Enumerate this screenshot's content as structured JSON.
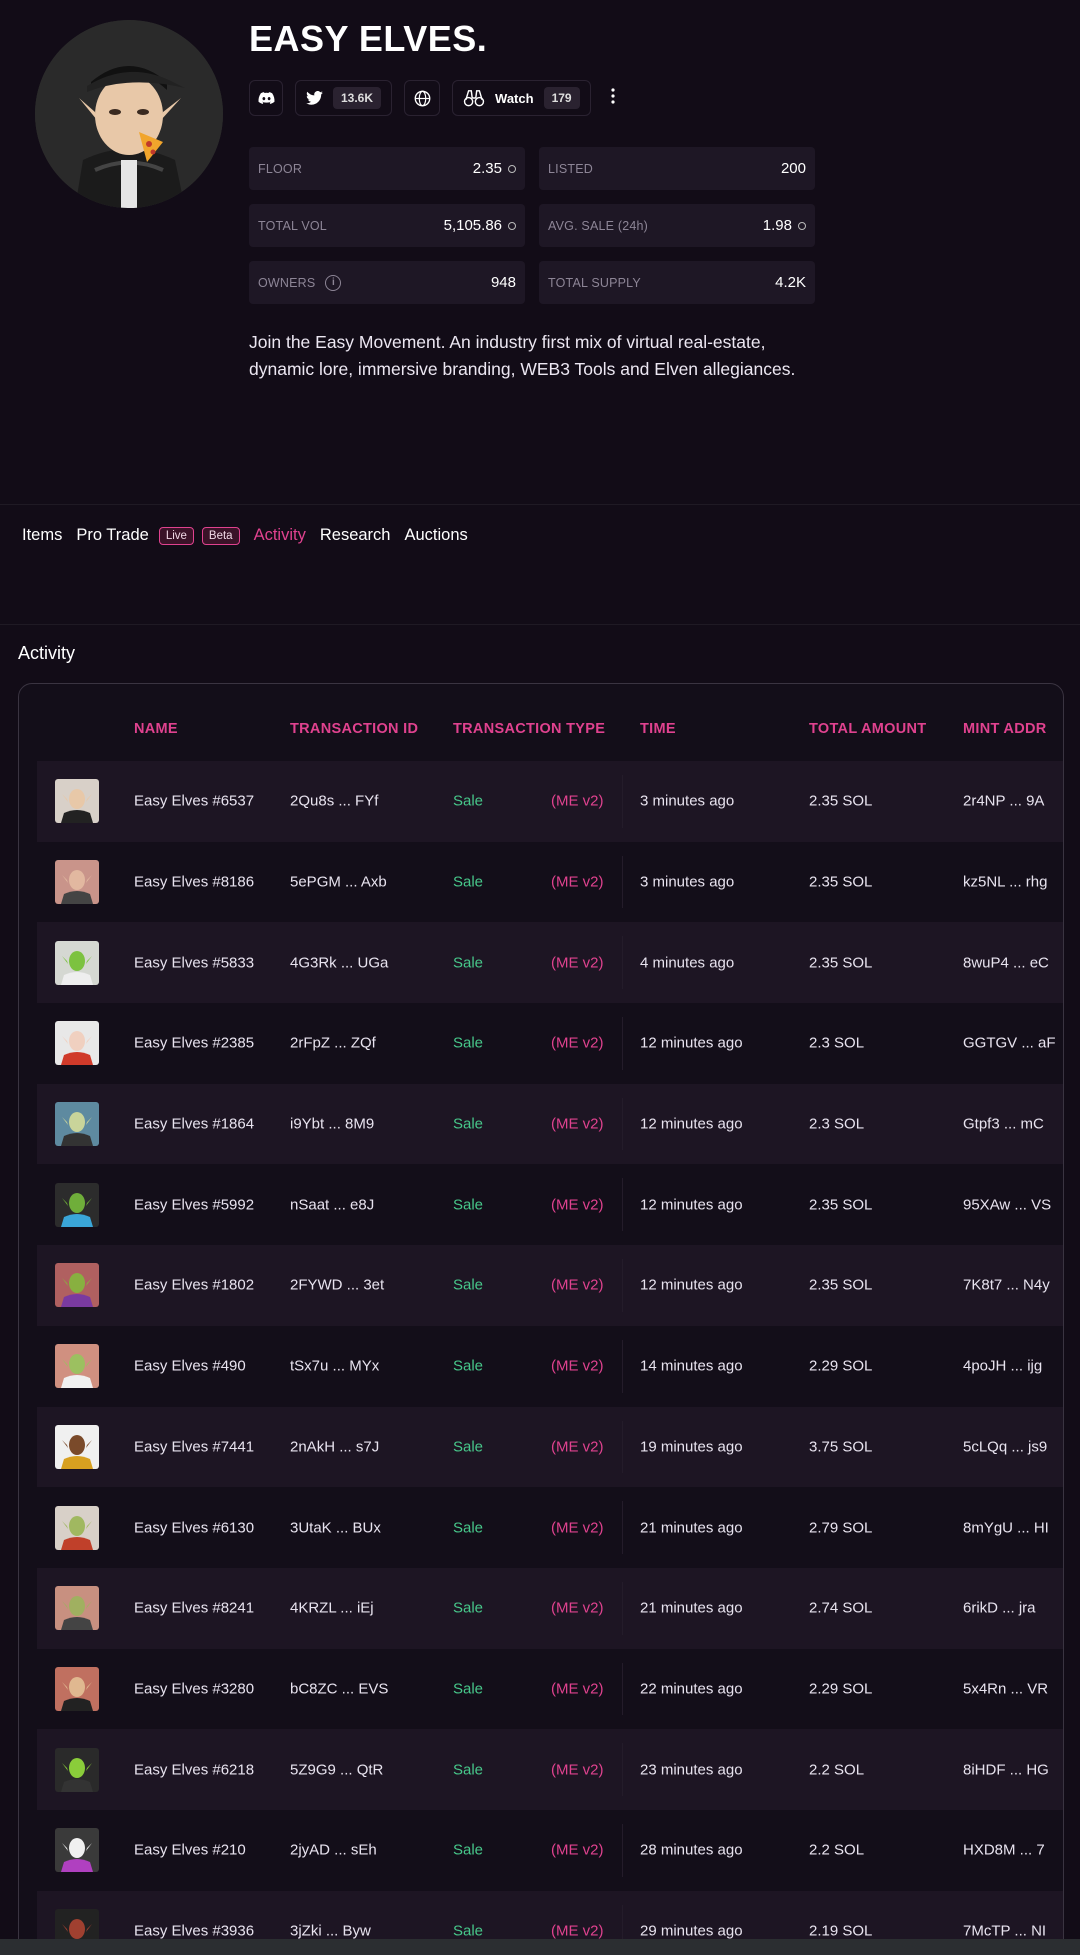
{
  "collection": {
    "title": "EASY ELVES.",
    "description": "Join the Easy Movement. An industry first mix of virtual real-estate, dynamic lore, immersive branding, WEB3 Tools and Elven allegiances."
  },
  "socials": {
    "discord_icon": "discord-icon",
    "twitter_icon": "twitter-icon",
    "twitter_count": "13.6K",
    "website_icon": "globe-icon",
    "watch_icon": "binoculars-icon",
    "watch_label": "Watch",
    "watch_count": "179",
    "more_icon": "kebab-icon"
  },
  "stats": {
    "floor_label": "FLOOR",
    "floor_value": "2.35",
    "listed_label": "LISTED",
    "listed_value": "200",
    "total_vol_label": "TOTAL VOL",
    "total_vol_value": "5,105.86",
    "avg_sale_label": "AVG. SALE (24h)",
    "avg_sale_value": "1.98",
    "owners_label": "OWNERS",
    "owners_value": "948",
    "supply_label": "TOTAL SUPPLY",
    "supply_value": "4.2K"
  },
  "tabs": {
    "items": "Items",
    "pro_trade": "Pro Trade",
    "badge_live": "Live",
    "badge_beta": "Beta",
    "activity": "Activity",
    "research": "Research",
    "auctions": "Auctions"
  },
  "activity": {
    "section_title": "Activity",
    "columns": [
      "NAME",
      "TRANSACTION ID",
      "TRANSACTION TYPE",
      "TIME",
      "TOTAL AMOUNT",
      "MINT ADDR"
    ],
    "rows": [
      {
        "name": "Easy Elves #6537",
        "tx": "2Qu8s ... FYf",
        "type": "Sale",
        "market": "(ME v2)",
        "time": "3 minutes ago",
        "amount": "2.35 SOL",
        "mint": "2r4NP ... 9A"
      },
      {
        "name": "Easy Elves #8186",
        "tx": "5ePGM ... Axb",
        "type": "Sale",
        "market": "(ME v2)",
        "time": "3 minutes ago",
        "amount": "2.35 SOL",
        "mint": "kz5NL ... rhg"
      },
      {
        "name": "Easy Elves #5833",
        "tx": "4G3Rk ... UGa",
        "type": "Sale",
        "market": "(ME v2)",
        "time": "4 minutes ago",
        "amount": "2.35 SOL",
        "mint": "8wuP4 ... eC"
      },
      {
        "name": "Easy Elves #2385",
        "tx": "2rFpZ ... ZQf",
        "type": "Sale",
        "market": "(ME v2)",
        "time": "12 minutes ago",
        "amount": "2.3 SOL",
        "mint": "GGTGV ... aF"
      },
      {
        "name": "Easy Elves #1864",
        "tx": "i9Ybt ... 8M9",
        "type": "Sale",
        "market": "(ME v2)",
        "time": "12 minutes ago",
        "amount": "2.3 SOL",
        "mint": "Gtpf3 ... mC"
      },
      {
        "name": "Easy Elves #5992",
        "tx": "nSaat ... e8J",
        "type": "Sale",
        "market": "(ME v2)",
        "time": "12 minutes ago",
        "amount": "2.35 SOL",
        "mint": "95XAw ... VS"
      },
      {
        "name": "Easy Elves #1802",
        "tx": "2FYWD ... 3et",
        "type": "Sale",
        "market": "(ME v2)",
        "time": "12 minutes ago",
        "amount": "2.35 SOL",
        "mint": "7K8t7 ... N4y"
      },
      {
        "name": "Easy Elves #490",
        "tx": "tSx7u ... MYx",
        "type": "Sale",
        "market": "(ME v2)",
        "time": "14 minutes ago",
        "amount": "2.29 SOL",
        "mint": "4poJH ... ijg"
      },
      {
        "name": "Easy Elves #7441",
        "tx": "2nAkH ... s7J",
        "type": "Sale",
        "market": "(ME v2)",
        "time": "19 minutes ago",
        "amount": "3.75 SOL",
        "mint": "5cLQq ... js9"
      },
      {
        "name": "Easy Elves #6130",
        "tx": "3UtaK ... BUx",
        "type": "Sale",
        "market": "(ME v2)",
        "time": "21 minutes ago",
        "amount": "2.79 SOL",
        "mint": "8mYgU ... HI"
      },
      {
        "name": "Easy Elves #8241",
        "tx": "4KRZL ... iEj",
        "type": "Sale",
        "market": "(ME v2)",
        "time": "21 minutes ago",
        "amount": "2.74 SOL",
        "mint": "6rikD ... jra"
      },
      {
        "name": "Easy Elves #3280",
        "tx": "bC8ZC ... EVS",
        "type": "Sale",
        "market": "(ME v2)",
        "time": "22 minutes ago",
        "amount": "2.29 SOL",
        "mint": "5x4Rn ... VR"
      },
      {
        "name": "Easy Elves #6218",
        "tx": "5Z9G9 ... QtR",
        "type": "Sale",
        "market": "(ME v2)",
        "time": "23 minutes ago",
        "amount": "2.2 SOL",
        "mint": "8iHDF ... HG"
      },
      {
        "name": "Easy Elves #210",
        "tx": "2jyAD ... sEh",
        "type": "Sale",
        "market": "(ME v2)",
        "time": "28 minutes ago",
        "amount": "2.2 SOL",
        "mint": "HXD8M ... 7"
      },
      {
        "name": "Easy Elves #3936",
        "tx": "3jZki ... Byw",
        "type": "Sale",
        "market": "(ME v2)",
        "time": "29 minutes ago",
        "amount": "2.19 SOL",
        "mint": "7McTP ... NI"
      }
    ]
  },
  "colors": {
    "accent": "#e0428f",
    "sale_green": "#47c78a",
    "background": "#120c17"
  }
}
